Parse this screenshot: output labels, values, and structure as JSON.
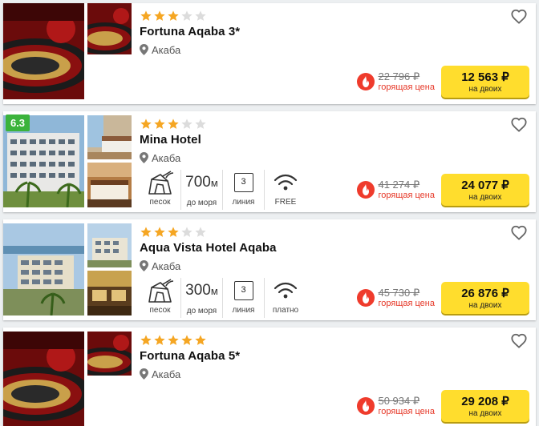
{
  "colors": {
    "star_on": "#f5a623",
    "star_off": "#dcdcdc",
    "price_button": "#ffdd2d",
    "hot": "#e63727",
    "rating_badge": "#3bb33b"
  },
  "hotels": [
    {
      "name": "Fortuna Aqaba 3*",
      "stars": 3,
      "location": "Акаба",
      "old_price": "22 796 ₽",
      "hot_label": "горящая цена",
      "price": "12 563 ₽",
      "price_sub": "на двоих"
    },
    {
      "name": "Mina Hotel",
      "stars": 3,
      "rating": "6.3",
      "location": "Акаба",
      "beach_label": "песок",
      "distance_value": "700",
      "distance_unit": "м",
      "distance_label": "до моря",
      "line_value": "3",
      "line_label": "линия",
      "wifi_label": "FREE",
      "old_price": "41 274 ₽",
      "hot_label": "горящая цена",
      "price": "24 077 ₽",
      "price_sub": "на двоих"
    },
    {
      "name": "Aqua Vista Hotel Aqaba",
      "stars": 3,
      "location": "Акаба",
      "beach_label": "песок",
      "distance_value": "300",
      "distance_unit": "м",
      "distance_label": "до моря",
      "line_value": "3",
      "line_label": "линия",
      "wifi_label": "платно",
      "old_price": "45 730 ₽",
      "hot_label": "горящая цена",
      "price": "26 876 ₽",
      "price_sub": "на двоих"
    },
    {
      "name": "Fortuna Aqaba 5*",
      "stars": 5,
      "location": "Акаба",
      "old_price": "50 934 ₽",
      "hot_label": "горящая цена",
      "price": "29 208 ₽",
      "price_sub": "на двоих"
    }
  ]
}
